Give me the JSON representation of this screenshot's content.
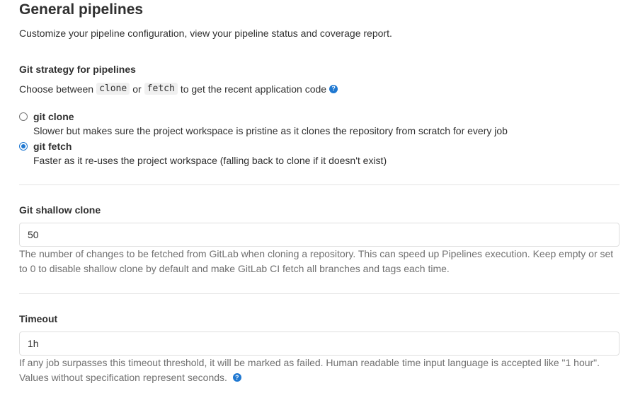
{
  "header": {
    "title": "General pipelines",
    "subtitle": "Customize your pipeline configuration, view your pipeline status and coverage report."
  },
  "git_strategy": {
    "label": "Git strategy for pipelines",
    "desc_prefix": "Choose between",
    "code_clone": "clone",
    "desc_or": "or",
    "code_fetch": "fetch",
    "desc_suffix": "to get the recent application code",
    "options": [
      {
        "label": "git clone",
        "help": "Slower but makes sure the project workspace is pristine as it clones the repository from scratch for every job",
        "checked": false
      },
      {
        "label": "git fetch",
        "help": "Faster as it re-uses the project workspace (falling back to clone if it doesn't exist)",
        "checked": true
      }
    ]
  },
  "shallow_clone": {
    "label": "Git shallow clone",
    "value": "50",
    "help": "The number of changes to be fetched from GitLab when cloning a repository. This can speed up Pipelines execution. Keep empty or set to 0 to disable shallow clone by default and make GitLab CI fetch all branches and tags each time."
  },
  "timeout": {
    "label": "Timeout",
    "value": "1h",
    "help": "If any job surpasses this timeout threshold, it will be marked as failed. Human readable time input language is accepted like \"1 hour\". Values without specification represent seconds."
  },
  "icons": {
    "help_glyph": "?",
    "help_color": "#1f78d1"
  }
}
